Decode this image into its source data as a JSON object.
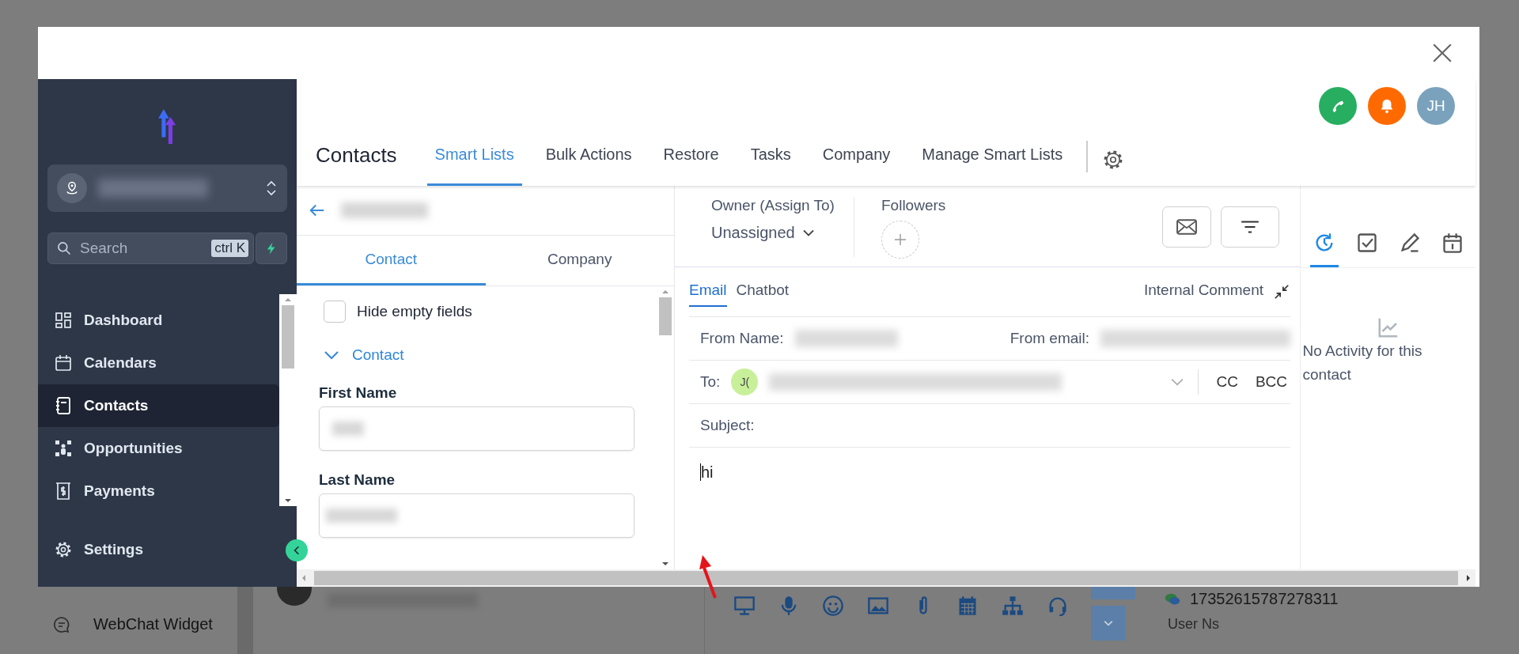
{
  "background": {
    "nav_item": "WebChat Widget",
    "phone": "17352615787278311",
    "field_label": "User Ns"
  },
  "modal": {
    "sidebar": {
      "search": {
        "placeholder": "Search",
        "shortcut": "ctrl K"
      },
      "items": [
        {
          "label": "Dashboard",
          "kind": "dashboard",
          "selected": false
        },
        {
          "label": "Calendars",
          "kind": "calendar",
          "selected": false
        },
        {
          "label": "Contacts",
          "kind": "contacts",
          "selected": true
        },
        {
          "label": "Opportunities",
          "kind": "opportunities",
          "selected": false
        },
        {
          "label": "Payments",
          "kind": "payments",
          "selected": false
        }
      ],
      "settings": "Settings"
    },
    "header": {
      "title": "Contacts",
      "avatar": "JH",
      "tabs": [
        {
          "label": "Smart Lists",
          "selected": true
        },
        {
          "label": "Bulk Actions",
          "selected": false
        },
        {
          "label": "Restore",
          "selected": false
        },
        {
          "label": "Tasks",
          "selected": false
        },
        {
          "label": "Company",
          "selected": false
        },
        {
          "label": "Manage Smart Lists",
          "selected": false
        }
      ]
    },
    "contact_panel": {
      "tabs": [
        {
          "label": "Contact",
          "selected": true
        },
        {
          "label": "Company",
          "selected": false
        }
      ],
      "hide_empty": {
        "label": "Hide empty fields",
        "checked": false
      },
      "section": {
        "label": "Contact",
        "expanded": true
      },
      "fields": [
        {
          "label": "First Name"
        },
        {
          "label": "Last Name"
        }
      ]
    },
    "owner": {
      "label": "Owner (Assign To)",
      "value": "Unassigned"
    },
    "followers": {
      "label": "Followers"
    },
    "composer": {
      "tabs": [
        {
          "label": "Email",
          "selected": true
        },
        {
          "label": "Chatbot",
          "selected": false
        }
      ],
      "internal_comment": "Internal Comment",
      "from_name_label": "From Name:",
      "from_email_label": "From email:",
      "to_label": "To:",
      "to_chip": "J(",
      "cc": "CC",
      "bcc": "BCC",
      "subject_label": "Subject:",
      "body": "hi"
    },
    "activity": {
      "tabs": [
        {
          "kind": "history",
          "selected": true
        },
        {
          "kind": "task",
          "selected": false
        },
        {
          "kind": "note",
          "selected": false
        },
        {
          "kind": "calendar",
          "selected": false
        }
      ],
      "empty": "No Activity for this contact"
    }
  }
}
